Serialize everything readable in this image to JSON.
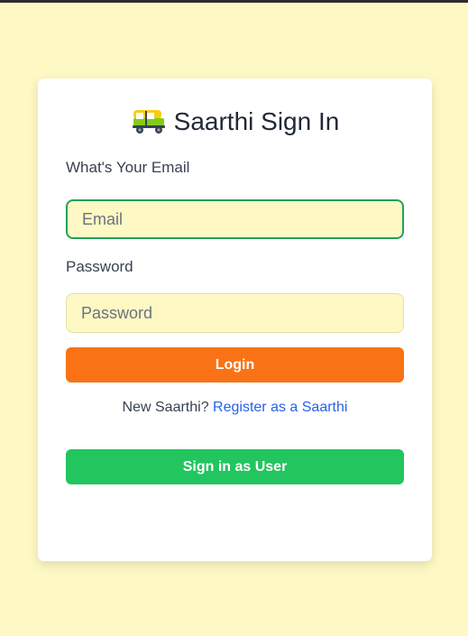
{
  "page": {
    "title": "Saarthi Sign In",
    "logo_icon": "auto-rickshaw-icon"
  },
  "form": {
    "email_label": "What's Your Email",
    "email_placeholder": "Email",
    "email_value": "",
    "password_label": "Password",
    "password_placeholder": "Password",
    "password_value": "",
    "login_label": "Login"
  },
  "register": {
    "prompt": "New Saarthi?",
    "link_text": "Register as a Saarthi"
  },
  "alt_signin": {
    "label": "Sign in as User"
  },
  "colors": {
    "background": "#fef8c4",
    "login_button": "#f97316",
    "user_button": "#22c55e",
    "link": "#2563eb",
    "focus_border": "#22a05a"
  }
}
